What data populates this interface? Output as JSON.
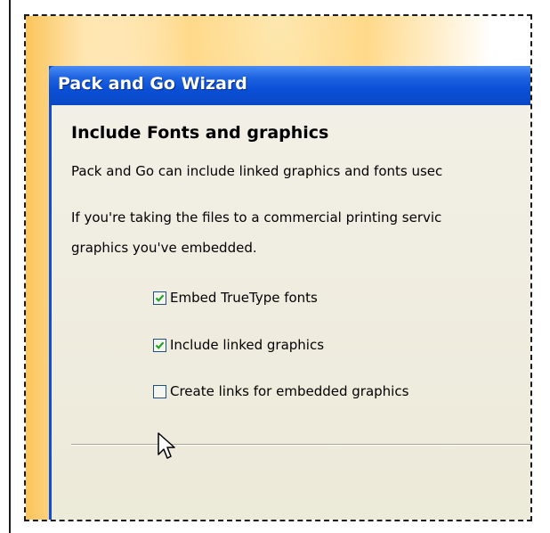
{
  "window": {
    "title": "Pack and Go Wizard"
  },
  "content": {
    "heading": "Include Fonts and graphics",
    "paragraph1": "Pack and Go can include linked graphics and fonts usec",
    "paragraph2_line1": "If you're taking the files to a commercial printing servic",
    "paragraph2_line2": "graphics you've embedded."
  },
  "options": [
    {
      "label": "Embed TrueType fonts",
      "checked": true
    },
    {
      "label": "Include linked graphics",
      "checked": true
    },
    {
      "label": "Create links for embedded graphics",
      "checked": false
    }
  ],
  "colors": {
    "titlebar": "#0a4fd6",
    "check": "#21a121",
    "dialog_bg": "#ece9d8"
  },
  "icons": {
    "cursor": "arrow-pointer-icon",
    "check": "checkmark-icon"
  }
}
